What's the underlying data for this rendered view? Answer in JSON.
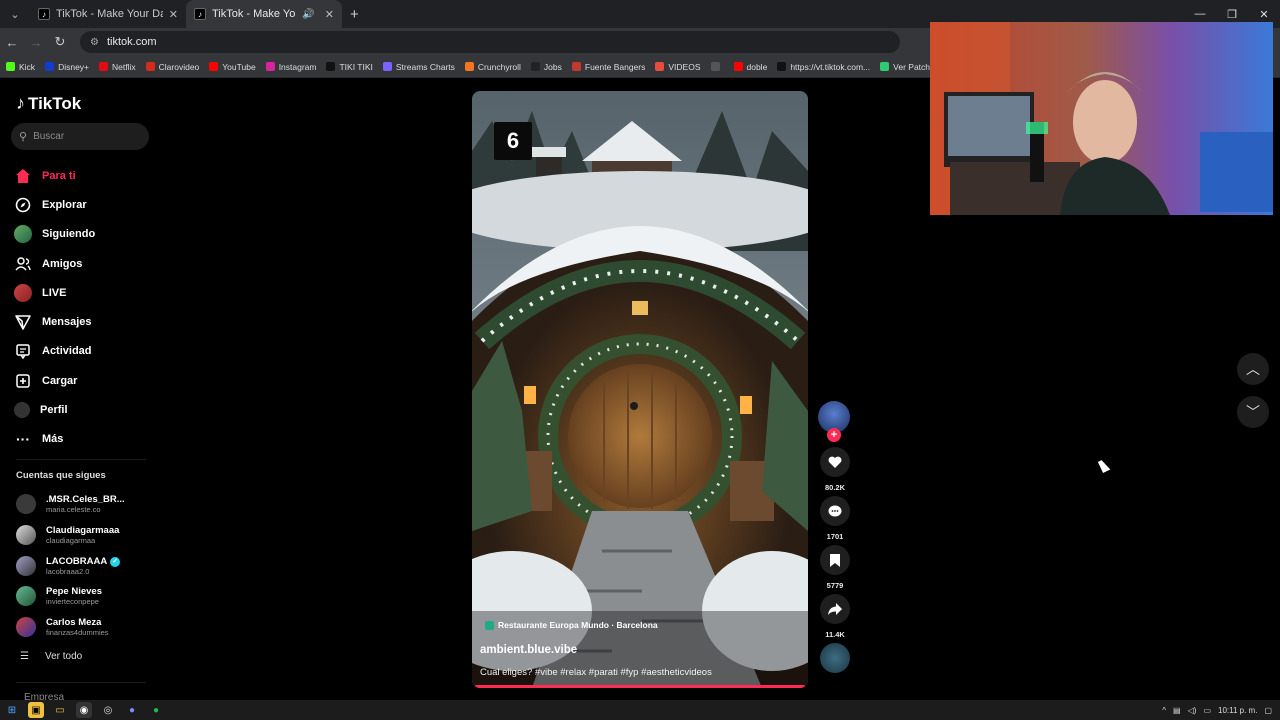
{
  "browser": {
    "tabs": [
      {
        "title": "TikTok - Make Your Day",
        "active": false,
        "audio": false
      },
      {
        "title": "TikTok - Make Your Day",
        "active": true,
        "audio": true
      }
    ],
    "url": "tiktok.com",
    "bookmarks": [
      {
        "label": "Kick",
        "color": "#53fc18"
      },
      {
        "label": "Disney+",
        "color": "#113ccf"
      },
      {
        "label": "Netflix",
        "color": "#e50914"
      },
      {
        "label": "Clarovideo",
        "color": "#d52b1e"
      },
      {
        "label": "YouTube",
        "color": "#ff0000"
      },
      {
        "label": "Instagram",
        "color": "#d6249f"
      },
      {
        "label": "TIKI TIKI",
        "color": "#111111"
      },
      {
        "label": "Streams Charts",
        "color": "#7b61ff"
      },
      {
        "label": "Crunchyroll",
        "color": "#f47521"
      },
      {
        "label": "Jobs",
        "color": "#222222"
      },
      {
        "label": "Fuente Bangers",
        "color": "#c0392b"
      },
      {
        "label": "VIDEOS",
        "color": "#e74c3c"
      },
      {
        "label": "",
        "color": "#555555"
      },
      {
        "label": "doble",
        "color": "#ff0000"
      },
      {
        "label": "https://vt.tiktok.com...",
        "color": "#111111"
      },
      {
        "label": "Ver Patch A",
        "color": "#2ecc71"
      }
    ]
  },
  "sidebar": {
    "logo": "TikTok",
    "search_placeholder": "Buscar",
    "menu": [
      {
        "label": "Para ti",
        "icon": "home-icon"
      },
      {
        "label": "Explorar",
        "icon": "compass-icon"
      },
      {
        "label": "Siguiendo",
        "icon": "following-avatar"
      },
      {
        "label": "Amigos",
        "icon": "friends-icon"
      },
      {
        "label": "LIVE",
        "icon": "live-avatar"
      },
      {
        "label": "Mensajes",
        "icon": "send-icon"
      },
      {
        "label": "Actividad",
        "icon": "activity-icon"
      },
      {
        "label": "Cargar",
        "icon": "upload-icon"
      },
      {
        "label": "Perfil",
        "icon": "profile-avatar"
      },
      {
        "label": "Más",
        "icon": "more-icon"
      }
    ],
    "following_title": "Cuentas que sigues",
    "accounts": [
      {
        "name": ".MSR.Celes_BR...",
        "handle": "maria.celeste.co",
        "verified": false
      },
      {
        "name": "Claudiagarmaaa",
        "handle": "claudiagarmaa",
        "verified": false
      },
      {
        "name": "LACOBRAAA",
        "handle": "lacobraaa2.0",
        "verified": true
      },
      {
        "name": "Pepe Nieves",
        "handle": "invierteconpepe",
        "verified": false
      },
      {
        "name": "Carlos Meza",
        "handle": "finanzas4dummies",
        "verified": false
      }
    ],
    "see_all": "Ver todo",
    "footer_partial": "Empresa"
  },
  "video": {
    "overlay_number": "6",
    "location": "Restaurante Europa Mundo · Barcelona",
    "author": "ambient.blue.vibe",
    "caption": "Cual eliges? #vibe #relax #parati #fyp #aestheticvideos",
    "progress": 1.0
  },
  "actions": {
    "likes": "80.2K",
    "comments": "1701",
    "saves": "5779",
    "shares": "11.4K"
  },
  "taskbar": {
    "time": "10:11 p. m."
  }
}
